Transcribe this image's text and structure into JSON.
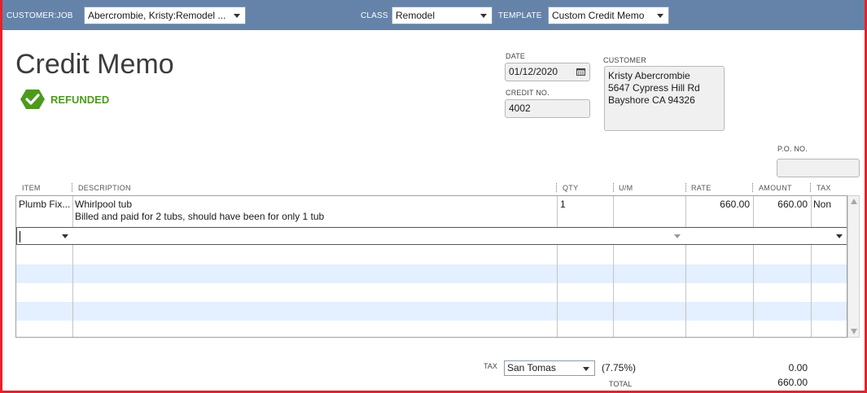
{
  "toolbar": {
    "customer_job_label": "CUSTOMER:JOB",
    "customer_job_value": "Abercrombie, Kristy:Remodel ...",
    "class_label": "CLASS",
    "class_value": "Remodel",
    "template_label": "TEMPLATE",
    "template_value": "Custom Credit Memo"
  },
  "form": {
    "title": "Credit Memo",
    "status": "REFUNDED",
    "date_label": "DATE",
    "date_value": "01/12/2020",
    "credit_no_label": "CREDIT NO.",
    "credit_no_value": "4002",
    "customer_label": "CUSTOMER",
    "customer_address": [
      "Kristy Abercrombie",
      "5647 Cypress Hill Rd",
      "Bayshore CA 94326"
    ],
    "po_label": "P.O. NO.",
    "po_value": ""
  },
  "grid": {
    "headers": {
      "item": "ITEM",
      "description": "DESCRIPTION",
      "qty": "QTY",
      "um": "U/M",
      "rate": "RATE",
      "amount": "AMOUNT",
      "tax": "TAX"
    },
    "rows": [
      {
        "item": "Plumb Fix...",
        "description_line1": "Whirlpool tub",
        "description_line2": "Billed and paid for 2 tubs, should have been for only 1 tub",
        "qty": "1",
        "um": "",
        "rate": "660.00",
        "amount": "660.00",
        "tax": "Non"
      }
    ]
  },
  "totals": {
    "tax_label": "TAX",
    "tax_item": "San Tomas",
    "tax_rate": "(7.75%)",
    "tax_amount": "0.00",
    "total_label": "TOTAL",
    "total_amount": "660.00"
  },
  "colors": {
    "toolbar_bg": "#6583a9",
    "refunded_green": "#4e9a1f",
    "alt_row": "#e4efff",
    "frame_red": "#e8202a"
  }
}
